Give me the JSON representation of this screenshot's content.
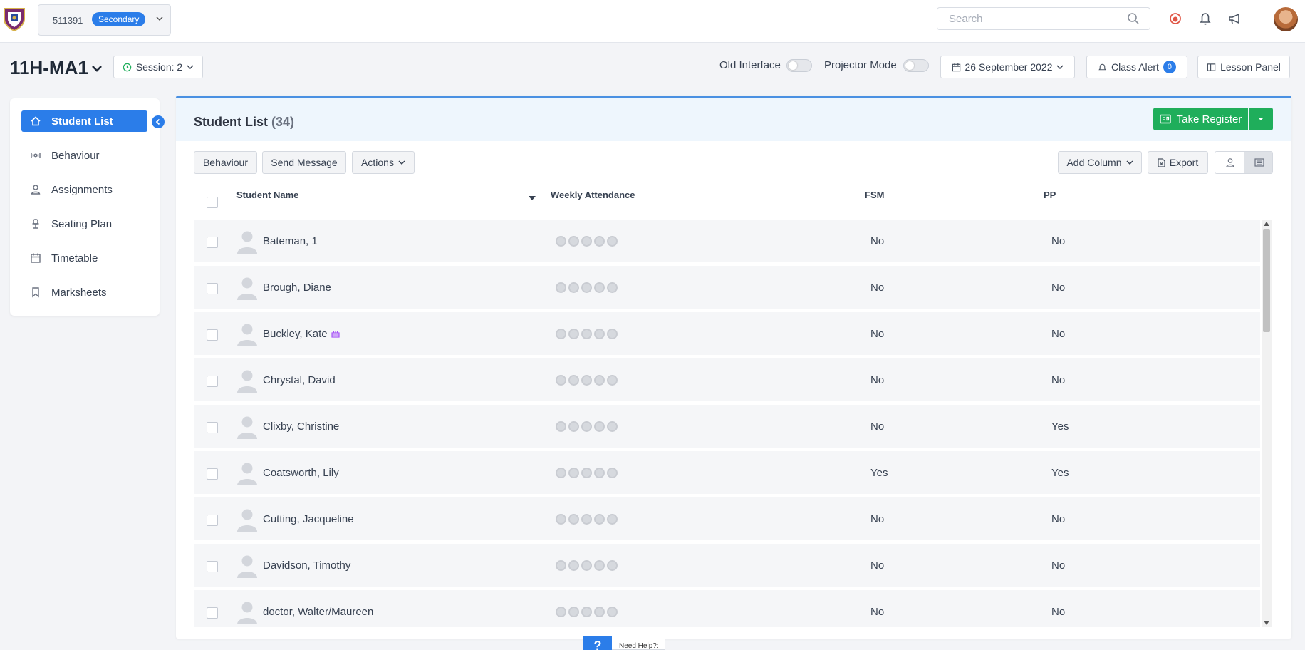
{
  "header": {
    "school_id": "511391",
    "school_badge": "Secondary",
    "search_placeholder": "Search"
  },
  "subbar": {
    "class_name": "11H-MA1",
    "session_label": "Session: 2",
    "old_interface_label": "Old Interface",
    "projector_mode_label": "Projector Mode",
    "date_label": "26 September 2022",
    "class_alert_label": "Class Alert",
    "class_alert_count": "0",
    "lesson_panel_label": "Lesson Panel"
  },
  "sidebar": {
    "items": [
      {
        "label": "Student List",
        "icon": "home-icon"
      },
      {
        "label": "Behaviour",
        "icon": "behaviour-icon"
      },
      {
        "label": "Assignments",
        "icon": "user-icon"
      },
      {
        "label": "Seating Plan",
        "icon": "chair-icon"
      },
      {
        "label": "Timetable",
        "icon": "calendar-icon"
      },
      {
        "label": "Marksheets",
        "icon": "bookmark-icon"
      }
    ]
  },
  "panel": {
    "title": "Student List",
    "count": "(34)",
    "take_register_label": "Take Register",
    "toolbar": {
      "behaviour": "Behaviour",
      "send_message": "Send Message",
      "actions": "Actions",
      "add_column": "Add Column",
      "export": "Export"
    },
    "columns": {
      "name": "Student Name",
      "attendance": "Weekly Attendance",
      "fsm": "FSM",
      "pp": "PP"
    },
    "rows": [
      {
        "name": "Bateman, 1",
        "fsm": "No",
        "pp": "No"
      },
      {
        "name": "Brough, Diane",
        "fsm": "No",
        "pp": "No"
      },
      {
        "name": "Buckley, Kate",
        "fsm": "No",
        "pp": "No",
        "birthday": true
      },
      {
        "name": "Chrystal, David",
        "fsm": "No",
        "pp": "No"
      },
      {
        "name": "Clixby, Christine",
        "fsm": "No",
        "pp": "Yes"
      },
      {
        "name": "Coatsworth, Lily",
        "fsm": "Yes",
        "pp": "Yes"
      },
      {
        "name": "Cutting, Jacqueline",
        "fsm": "No",
        "pp": "No"
      },
      {
        "name": "Davidson, Timothy",
        "fsm": "No",
        "pp": "No"
      },
      {
        "name": "doctor, Walter/Maureen",
        "fsm": "No",
        "pp": "No"
      }
    ]
  },
  "help": {
    "symbol": "?",
    "label": "Need Help?:"
  },
  "colors": {
    "primary": "#2b7de9",
    "success": "#1fae5b",
    "panel_header": "#eef6fd"
  }
}
